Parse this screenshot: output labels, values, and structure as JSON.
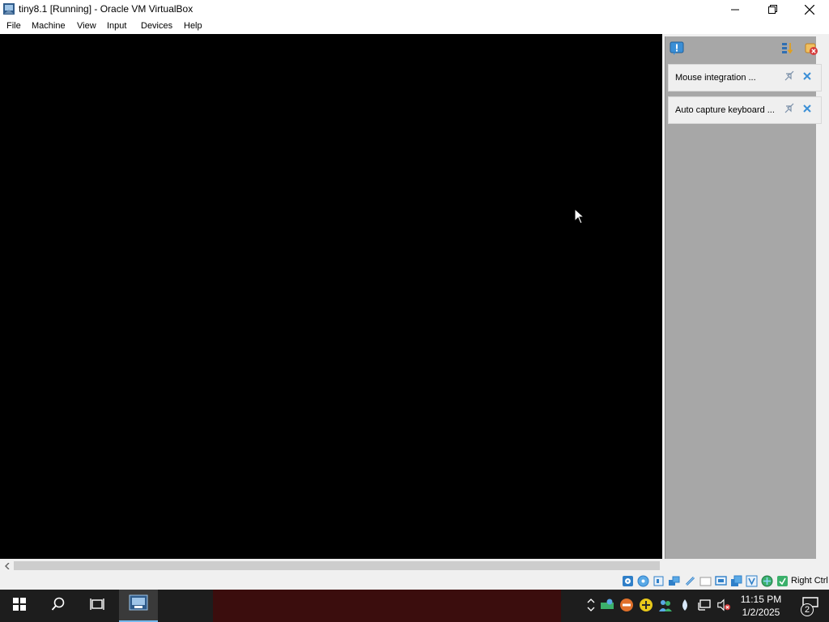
{
  "window": {
    "title": "tiny8.1 [Running] - Oracle VM VirtualBox",
    "icon": "virtualbox-icon",
    "controls": [
      "minimize-icon",
      "restore-icon",
      "close-icon"
    ]
  },
  "menubar": {
    "items": [
      "File",
      "Machine",
      "View",
      "Input",
      "Devices",
      "Help"
    ]
  },
  "notification_panel": {
    "tools": [
      "notification-center-icon",
      "sort-icon",
      "dismiss-all-icon"
    ],
    "cards": [
      {
        "text": "Mouse integration ...",
        "actions": [
          "pin-icon",
          "close-icon"
        ]
      },
      {
        "text": "Auto capture keyboard ...",
        "actions": [
          "pin-icon",
          "close-icon"
        ]
      }
    ]
  },
  "statusbar": {
    "indicators": [
      "hard-disk-icon",
      "optical-drive-icon",
      "audio-icon",
      "network-icon",
      "usb-icon",
      "shared-folders-icon",
      "display-icon",
      "video-capture-icon",
      "recording-icon",
      "cpu-icon",
      "features-icon",
      "mouse-integration-icon",
      "keyboard-icon"
    ],
    "host_key": "Right Ctrl"
  },
  "taskbar": {
    "buttons": [
      "start-icon",
      "search-icon",
      "task-view-icon",
      "virtualbox-taskbar-icon"
    ],
    "tray_icons": [
      "show-hidden-icons-icon",
      "network-app-icon",
      "stop-icon",
      "plus-icon",
      "people-icon",
      "drop-icon",
      "network-status-icon",
      "volume-muted-icon"
    ],
    "time": "11:15 PM",
    "date": "1/2/2025",
    "notification_count": "2"
  },
  "colors": {
    "vm_screen": "#000000",
    "panel_bg": "#a7a7a7",
    "taskbar_bg": "#1d1d1d",
    "accent": "#76b9ed"
  }
}
